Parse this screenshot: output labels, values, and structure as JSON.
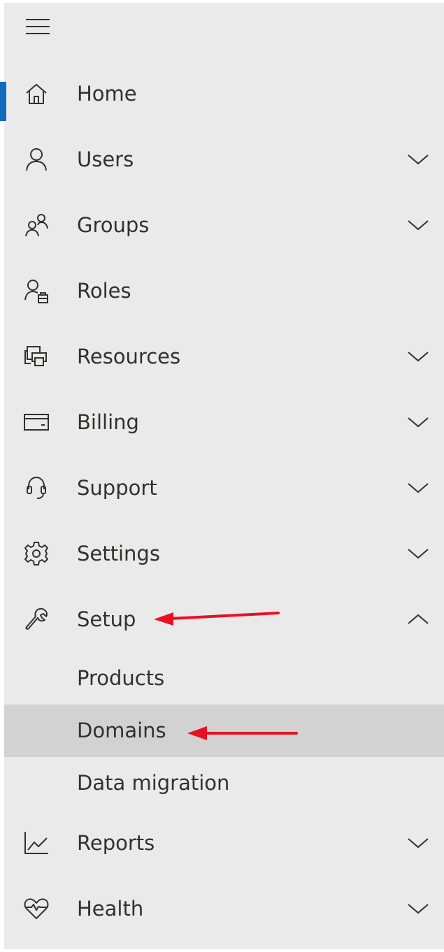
{
  "nav": {
    "accent_color": "#0f6cbd",
    "selected_background": "#d2d2d2",
    "annotation_arrow_color": "#e81123",
    "collapse_icon": "hamburger-icon",
    "items": [
      {
        "label": "Home",
        "icon": "home-icon",
        "active": true
      },
      {
        "label": "Users",
        "icon": "user-icon",
        "expandable": true
      },
      {
        "label": "Groups",
        "icon": "groups-icon",
        "expandable": true
      },
      {
        "label": "Roles",
        "icon": "roles-icon"
      },
      {
        "label": "Resources",
        "icon": "resources-icon",
        "expandable": true
      },
      {
        "label": "Billing",
        "icon": "billing-icon",
        "expandable": true
      },
      {
        "label": "Support",
        "icon": "headset-icon",
        "expandable": true
      },
      {
        "label": "Settings",
        "icon": "gear-icon",
        "expandable": true
      },
      {
        "label": "Setup",
        "icon": "wrench-icon",
        "expandable": true,
        "expanded": true
      },
      {
        "label": "Reports",
        "icon": "line-chart-icon",
        "expandable": true
      },
      {
        "label": "Health",
        "icon": "heart-pulse-icon",
        "expandable": true
      }
    ],
    "setup_children": [
      {
        "label": "Products"
      },
      {
        "label": "Domains",
        "selected": true
      },
      {
        "label": "Data migration"
      }
    ]
  }
}
